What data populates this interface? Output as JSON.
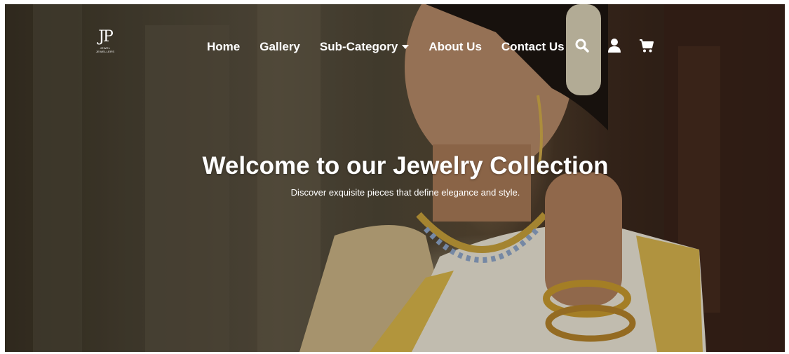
{
  "brand": {
    "logo_mark": "JP",
    "logo_subtext": "JEWEL JEWELLERS"
  },
  "nav": {
    "items": [
      {
        "label": "Home"
      },
      {
        "label": "Gallery"
      },
      {
        "label": "Sub-Category"
      },
      {
        "label": "About Us"
      },
      {
        "label": "Contact Us"
      }
    ],
    "icons": [
      "search-icon",
      "user-icon",
      "cart-icon"
    ]
  },
  "hero": {
    "title": "Welcome to our Jewelry Collection",
    "subtitle": "Discover exquisite pieces that define elegance and style."
  },
  "colors": {
    "text": "#ffffff",
    "gold": "#d4a63a",
    "background_dark": "#3a3224"
  }
}
